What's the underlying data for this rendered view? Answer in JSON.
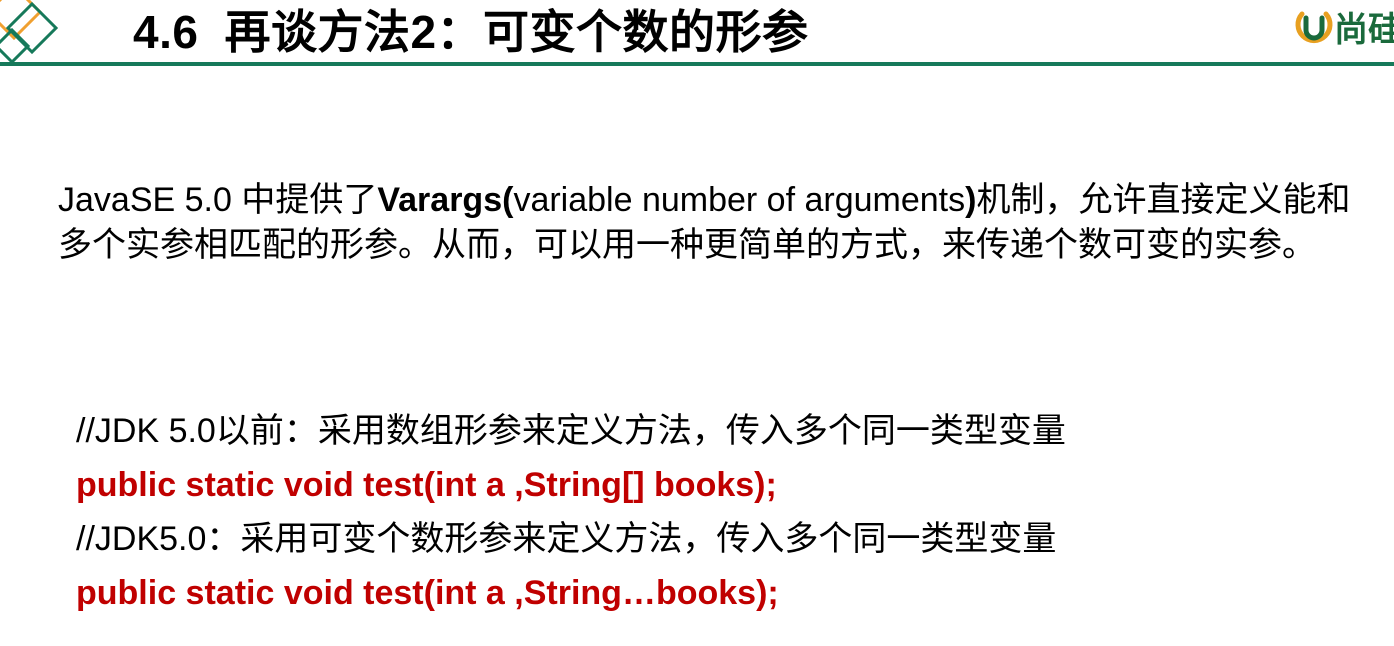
{
  "slide": {
    "title_number": "4.6",
    "title_text": "再谈方法2：可变个数的形参",
    "brand_text": "尚硅",
    "accent_color": "#16795a",
    "brand_color": "#1a6a3c",
    "code_color": "#c00000"
  },
  "intro": {
    "part1": "JavaSE 5.0 中提供了",
    "bold1": "Varargs(",
    "part2": "variable number of arguments",
    "bold2": ")",
    "part3": "机制，允许直接定义能和多个实参相匹配的形参。从而，可以用一种更简单的方式，来传递个数可变的实参。"
  },
  "code": {
    "comment1": "//JDK 5.0以前：采用数组形参来定义方法，传入多个同一类型变量",
    "line1": "public static void test(int a ,String[] books);",
    "comment2": "//JDK5.0：采用可变个数形参来定义方法，传入多个同一类型变量",
    "line2": "public static void test(int a ,String…books);"
  },
  "icons": {
    "corner_logo": "diamond-logo-icon",
    "brand_logo": "u-logo-icon"
  }
}
